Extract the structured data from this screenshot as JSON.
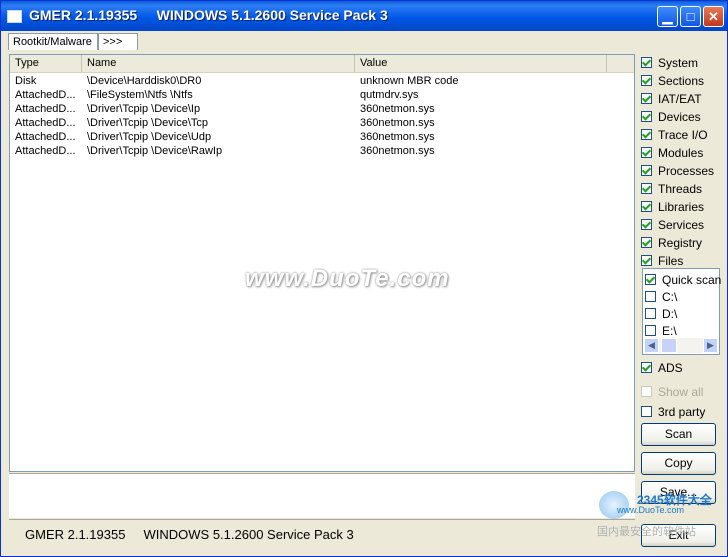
{
  "window": {
    "title": "GMER 2.1.19355     WINDOWS 5.1.2600 Service Pack 3",
    "controls": {
      "minimize": "▁",
      "maximize": "□",
      "close": "✕"
    }
  },
  "tabs": [
    {
      "label": "Rootkit/Malware"
    },
    {
      "label": ">>>"
    }
  ],
  "table": {
    "columns": [
      "Type",
      "Name",
      "Value"
    ],
    "rows": [
      [
        "Disk",
        "\\Device\\Harddisk0\\DR0",
        "unknown MBR code"
      ],
      [
        "AttachedD...",
        "\\FileSystem\\Ntfs \\Ntfs",
        "qutmdrv.sys"
      ],
      [
        "AttachedD...",
        "\\Driver\\Tcpip \\Device\\Ip",
        "360netmon.sys"
      ],
      [
        "AttachedD...",
        "\\Driver\\Tcpip \\Device\\Tcp",
        "360netmon.sys"
      ],
      [
        "AttachedD...",
        "\\Driver\\Tcpip \\Device\\Udp",
        "360netmon.sys"
      ],
      [
        "AttachedD...",
        "\\Driver\\Tcpip \\Device\\RawIp",
        "360netmon.sys"
      ]
    ]
  },
  "options": [
    {
      "label": "System",
      "checked": true
    },
    {
      "label": "Sections",
      "checked": true
    },
    {
      "label": "IAT/EAT",
      "checked": true
    },
    {
      "label": "Devices",
      "checked": true
    },
    {
      "label": "Trace I/O",
      "checked": true
    },
    {
      "label": "Modules",
      "checked": true
    },
    {
      "label": "Processes",
      "checked": true
    },
    {
      "label": "Threads",
      "checked": true
    },
    {
      "label": "Libraries",
      "checked": true
    },
    {
      "label": "Services",
      "checked": true
    },
    {
      "label": "Registry",
      "checked": true
    },
    {
      "label": "Files",
      "checked": true
    }
  ],
  "drives": [
    {
      "label": "Quick scan",
      "checked": true
    },
    {
      "label": "C:\\",
      "checked": false
    },
    {
      "label": "D:\\",
      "checked": false
    },
    {
      "label": "E:\\",
      "checked": false
    }
  ],
  "extra_options": [
    {
      "label": "ADS",
      "checked": true,
      "disabled": false
    },
    {
      "label": "Show all",
      "checked": false,
      "disabled": true
    },
    {
      "label": "3rd party",
      "checked": false,
      "disabled": false
    }
  ],
  "buttons": {
    "scan": "Scan",
    "copy": "Copy",
    "save": "Save...",
    "exit": "Exit"
  },
  "statusbar": {
    "text": "GMER 2.1.19355     WINDOWS 5.1.2600 Service Pack 3"
  },
  "watermark": {
    "main": "www.DuoTe.com",
    "logo_title": "2345软件大全",
    "logo_url": "www.DuoTe.com",
    "logo_tag": "国内最安全的软件站"
  }
}
